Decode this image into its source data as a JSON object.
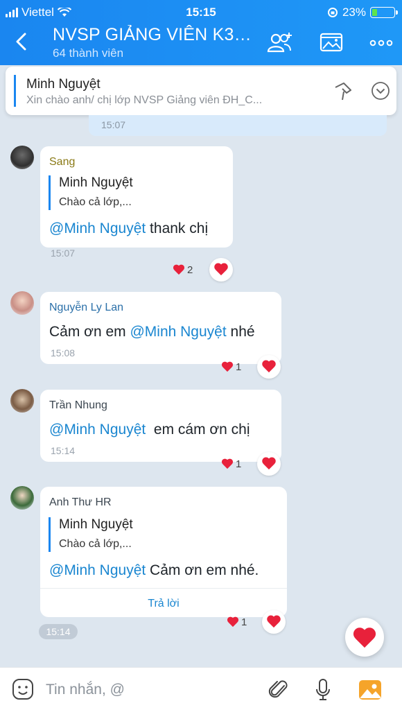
{
  "status_bar": {
    "carrier": "Viettel",
    "time": "15:15",
    "battery": "23%",
    "battery_level": 0.23
  },
  "header": {
    "title": "NVSP GIẢNG VIÊN K3.2...",
    "subtitle": "64 thành viên"
  },
  "pinned": {
    "name": "Minh Nguyệt",
    "text": "Xin chào anh/ chị lớp NVSP Giảng viên ĐH_C..."
  },
  "previous_message": {
    "time": "15:07"
  },
  "messages": [
    {
      "sender": "Sang",
      "quote_name": "Minh Nguyệt",
      "quote_text": "Chào cả lớp,...",
      "mention": "@Minh Nguyệt",
      "text_after": " thank chị",
      "time": "15:07",
      "reaction_count": "2"
    },
    {
      "sender": "Nguyễn Ly Lan",
      "text_before": "Cảm ơn em ",
      "mention": "@Minh Nguyệt",
      "text_after": " nhé",
      "time": "15:08",
      "reaction_count": "1"
    },
    {
      "sender": "Trần Nhung",
      "mention": "@Minh Nguyệt",
      "text_after": "  em cám ơn chị",
      "time": "15:14",
      "reaction_count": "1"
    },
    {
      "sender": "Anh Thư HR",
      "quote_name": "Minh Nguyệt",
      "quote_text": "Chào cả lớp,...",
      "mention": "@Minh Nguyệt",
      "text_after": " Cảm ơn em nhé.",
      "reply_label": "Trả lời",
      "reaction_count": "1"
    }
  ],
  "time_chip": "15:14",
  "input": {
    "placeholder": "Tin nhắn, @"
  },
  "colors": {
    "header": "#1a86f0",
    "mention": "#1a86d0",
    "heart": "#e8213b",
    "background": "#dde6ef"
  },
  "icons": [
    "back-icon",
    "add-member-icon",
    "media-icon",
    "more-icon",
    "pin-icon",
    "expand-icon",
    "heart-icon",
    "emoji-icon",
    "attach-icon",
    "mic-icon",
    "image-icon"
  ]
}
